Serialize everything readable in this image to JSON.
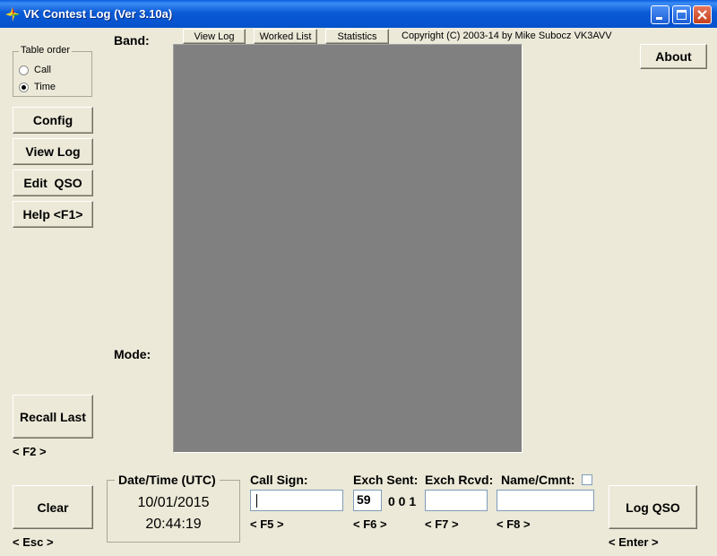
{
  "window": {
    "title": "VK Contest Log (Ver 3.10a)",
    "colors": {
      "titlebar": "#0a5ad6",
      "face": "#ece9d8",
      "display": "#808080"
    }
  },
  "table_order": {
    "legend": "Table order",
    "options": [
      {
        "label": "Call",
        "selected": false
      },
      {
        "label": "Time",
        "selected": true
      }
    ]
  },
  "left_buttons": {
    "config": "Config",
    "view_log": "View Log",
    "edit_qso": "Edit  QSO",
    "help": "Help <F1>",
    "recall_last": "Recall Last",
    "recall_hint": "< F2 >",
    "clear": "Clear",
    "clear_hint": "< Esc >"
  },
  "toolbar": {
    "view_log": "View Log",
    "worked_list": "Worked List",
    "statistics": "Statistics",
    "copyright": "Copyright (C) 2003-14 by Mike Subocz VK3AVV",
    "about": "About"
  },
  "labels": {
    "band": "Band:",
    "mode": "Mode:"
  },
  "datetime": {
    "legend": "Date/Time (UTC)",
    "date": "10/01/2015",
    "time": "20:44:19"
  },
  "entry": {
    "call_sign_label": "Call Sign:",
    "call_sign_value": "",
    "call_sign_hint": "< F5 >",
    "exch_sent_label": "Exch Sent:",
    "exch_sent_value": "59",
    "serial": "0 0 1",
    "exch_sent_hint": "< F6 >",
    "exch_rcvd_label": "Exch Rcvd:",
    "exch_rcvd_value": "",
    "exch_rcvd_hint": "< F7 >",
    "name_cmnt_label": "Name/Cmnt:",
    "name_cmnt_value": "",
    "name_cmnt_hint": "< F8 >"
  },
  "log_qso": {
    "label": "Log QSO",
    "hint": "< Enter >"
  }
}
